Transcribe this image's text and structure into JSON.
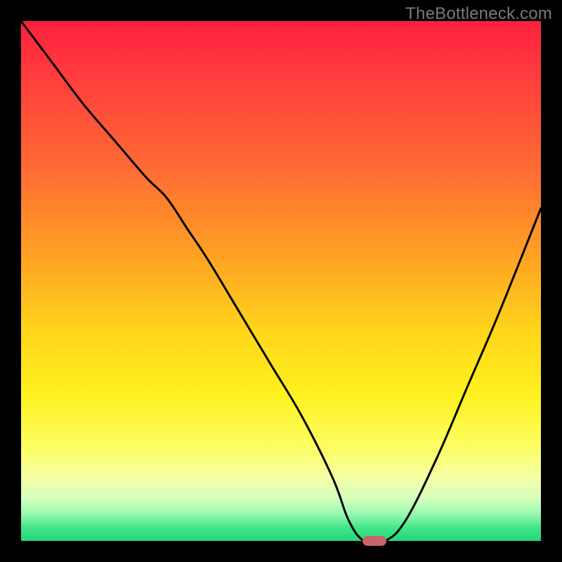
{
  "watermark": "TheBottleneck.com",
  "colors": {
    "frame": "#000000",
    "marker": "#cb6368",
    "curve": "#000000"
  },
  "chart_data": {
    "type": "line",
    "title": "",
    "xlabel": "",
    "ylabel": "",
    "xlim": [
      0,
      100
    ],
    "ylim": [
      0,
      100
    ],
    "grid": false,
    "legend": false,
    "background_gradient": {
      "orientation": "vertical",
      "stops": [
        {
          "pos": 0,
          "color": "#ff213f"
        },
        {
          "pos": 28,
          "color": "#ff6a34"
        },
        {
          "pos": 60,
          "color": "#ffd61a"
        },
        {
          "pos": 82,
          "color": "#fcff63"
        },
        {
          "pos": 95,
          "color": "#93f8ae"
        },
        {
          "pos": 100,
          "color": "#22d879"
        }
      ]
    },
    "series": [
      {
        "name": "bottleneck-curve",
        "x": [
          0,
          6,
          12,
          18,
          24,
          28,
          32,
          36,
          42,
          48,
          54,
          60,
          63,
          66,
          70,
          74,
          80,
          86,
          92,
          100
        ],
        "y": [
          100,
          92,
          84,
          77,
          70,
          66,
          60,
          54,
          44,
          34,
          24,
          12,
          4,
          0,
          0,
          4,
          16,
          30,
          44,
          64
        ]
      }
    ],
    "marker": {
      "shape": "pill",
      "x": 68,
      "y": 0,
      "width_pct": 4.6,
      "color": "#cb6368"
    }
  }
}
